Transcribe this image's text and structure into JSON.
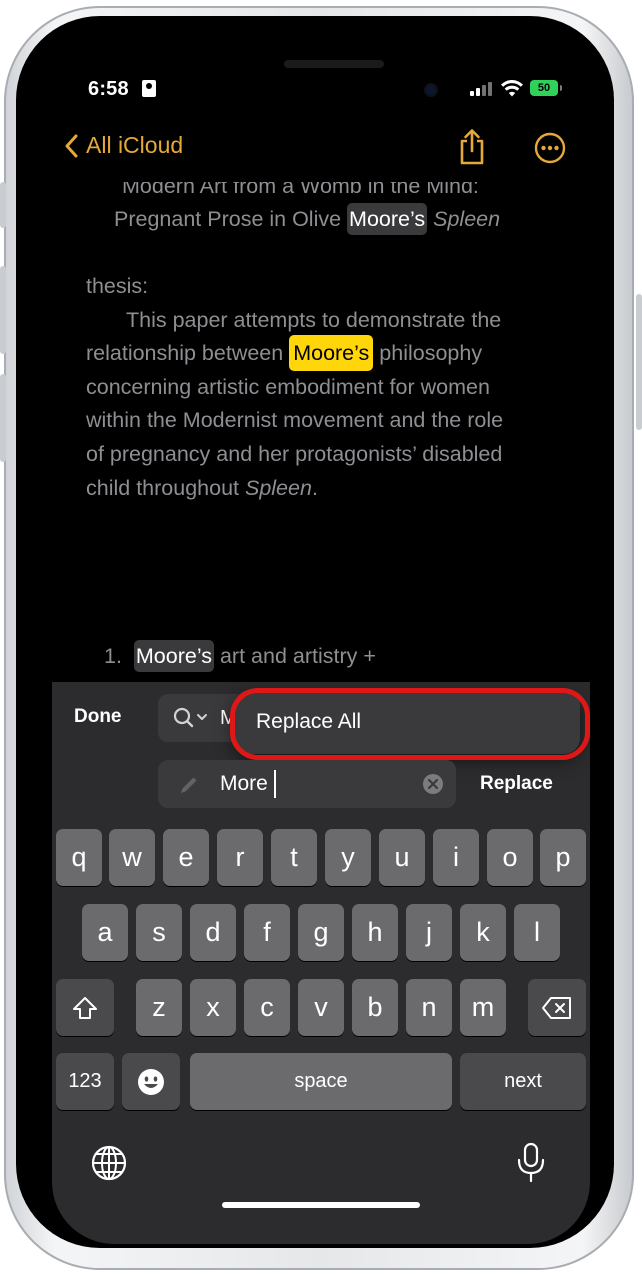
{
  "status": {
    "time": "6:58",
    "battery": "50"
  },
  "nav": {
    "back_label": "All iCloud"
  },
  "note": {
    "title_line1": "Modern Art from a Womb in the Mind:",
    "title_line2_pre": "Pregnant Prose in Olive ",
    "title_line2_match": "Moore’s",
    "title_line2_post": "Spleen",
    "thesis": "thesis:",
    "p1": "This paper attempts to demonstrate the",
    "p2_pre": "relationship between ",
    "p2_match": "Moore’s",
    "p2_post": "philosophy",
    "p3": "concerning artistic embodiment for women",
    "p4": "within the Modernist movement and the role",
    "p5": "of pregnancy and her protagonists’ disabled",
    "p6_pre": "child throughout ",
    "p6_ital": "Spleen",
    "p6_post": ".",
    "list_num": "1.",
    "list_match": "Moore’s",
    "list_post": "art and artistry +"
  },
  "find_replace": {
    "done_label": "Done",
    "search_value": "M",
    "replace_all_label": "Replace All",
    "replace_value": "More",
    "replace_label": "Replace"
  },
  "keyboard": {
    "row1": [
      "q",
      "w",
      "e",
      "r",
      "t",
      "y",
      "u",
      "i",
      "o",
      "p"
    ],
    "row2": [
      "a",
      "s",
      "d",
      "f",
      "g",
      "h",
      "j",
      "k",
      "l"
    ],
    "row3": [
      "z",
      "x",
      "c",
      "v",
      "b",
      "n",
      "m"
    ],
    "numbers_label": "123",
    "space_label": "space",
    "next_label": "next"
  },
  "colors": {
    "accent": "#e5a93a",
    "match_highlight": "#ffd60a",
    "callout": "#e01717"
  }
}
